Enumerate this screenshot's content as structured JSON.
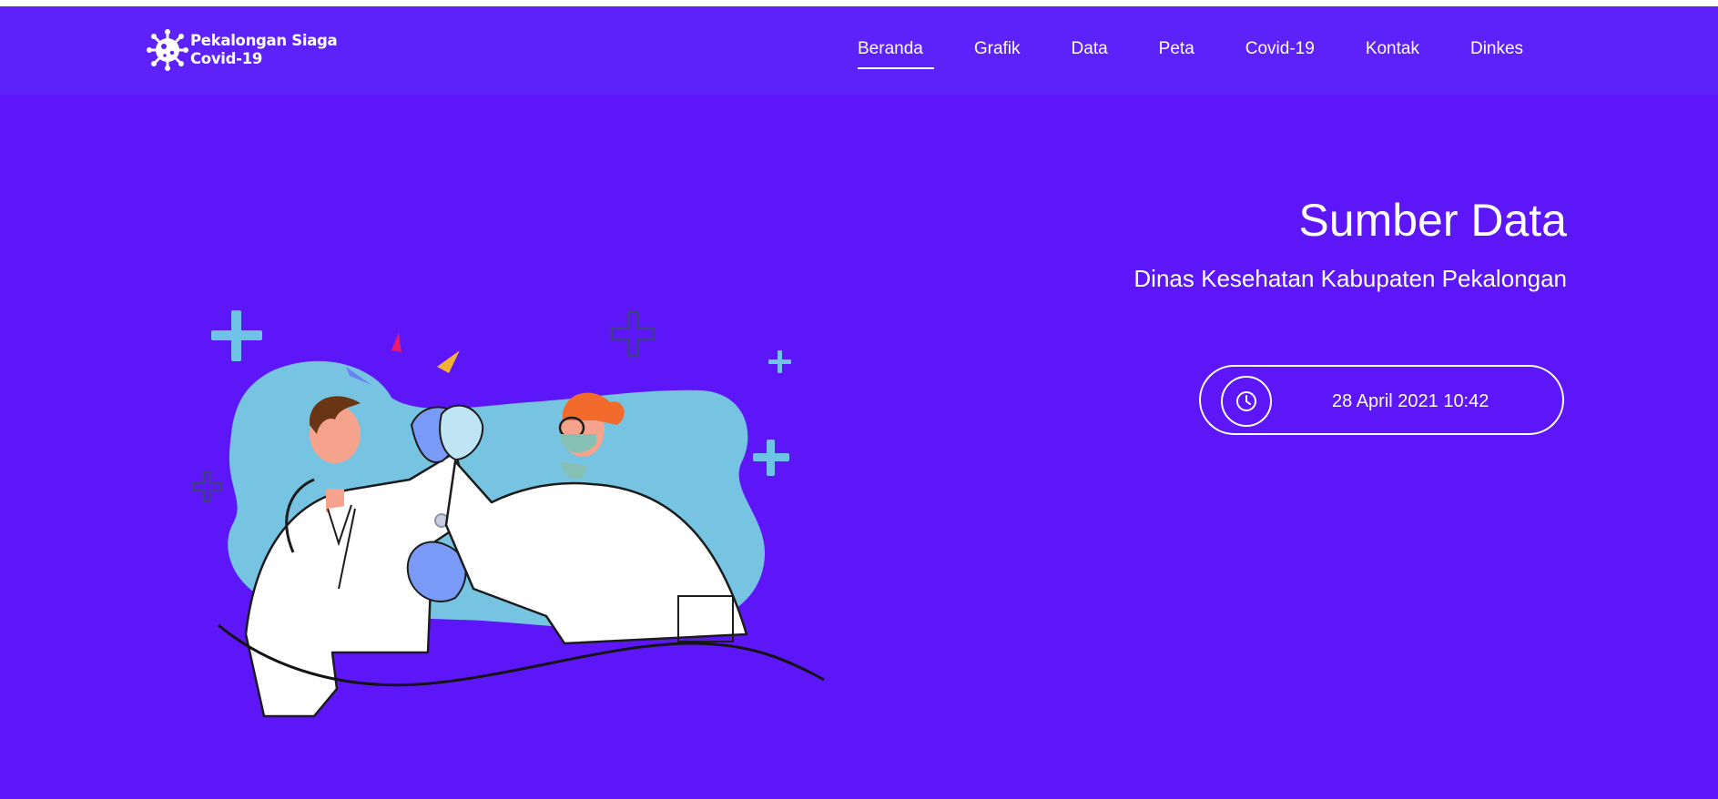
{
  "brand": {
    "line1": "Pekalongan Siaga",
    "line2": "Covid-19",
    "icon": "virus-icon"
  },
  "nav": {
    "items": [
      "Beranda",
      "Grafik",
      "Data",
      "Peta",
      "Covid-19",
      "Kontak",
      "Dinkes"
    ],
    "active": "Beranda"
  },
  "hero": {
    "title": "Sumber Data",
    "subtitle": "Dinas Kesehatan Kabupaten Pekalongan",
    "datetime": "28 April 2021 10:42",
    "datetime_icon": "clock-icon",
    "illustration": "doctors-high-five-illustration"
  },
  "colors": {
    "background": "#5c16f8",
    "navbar": "#5d22fa",
    "text": "#ffffff",
    "blob": "#76c4e2",
    "plus": "#6ec3e6"
  }
}
